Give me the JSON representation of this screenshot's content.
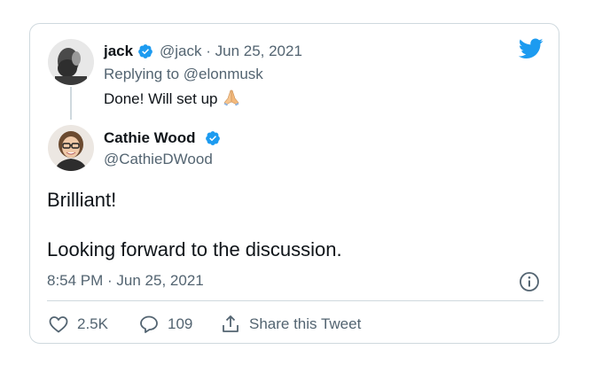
{
  "reply": {
    "name": "jack",
    "handle": "@jack",
    "date": "Jun 25, 2021",
    "replying_to_prefix": "Replying to",
    "replying_to_handle": "@elonmusk",
    "text": "Done! Will set up"
  },
  "tweet": {
    "name": "Cathie Wood",
    "handle": "@CathieDWood",
    "line1": "Brilliant!",
    "line2": "Looking forward to the discussion.",
    "timestamp": "8:54 PM · Jun 25, 2021"
  },
  "actions": {
    "likes": "2.5K",
    "replies": "109",
    "share_label": "Share this Tweet"
  },
  "colors": {
    "brand_blue": "#1d9bf0",
    "muted": "#536471",
    "border": "#cfd9de"
  },
  "icons": [
    "twitter-bird-icon",
    "verified-badge-icon",
    "praying-hands-emoji",
    "info-icon",
    "heart-icon",
    "reply-bubble-icon",
    "share-icon"
  ]
}
